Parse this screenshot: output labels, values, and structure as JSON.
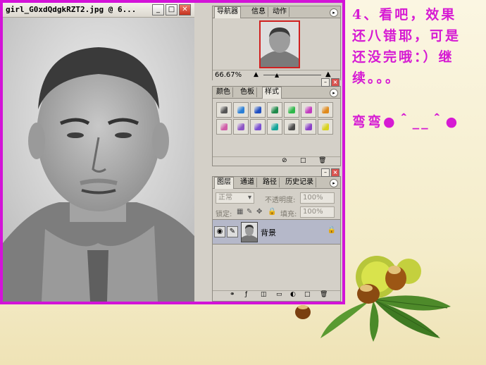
{
  "document": {
    "title": "girl_G0xdQdgkRZT2.jpg @ 6...",
    "minimize_icon": "minimize-icon",
    "maximize_icon": "maximize-icon",
    "close_icon": "close-icon"
  },
  "navigator_panel": {
    "tabs": [
      "导航器",
      "信息",
      "动作"
    ],
    "zoom": "66.67%"
  },
  "styles_panel": {
    "tabs": [
      "颜色",
      "色板",
      "样式"
    ],
    "swatch_colors": [
      "#555555",
      "#2a7fd6",
      "#1f4fc2",
      "#1e8a4a",
      "#2fb84a",
      "#c23bbf",
      "#e08a1c",
      "#d05da8",
      "#8d55c4",
      "#7a4fd1",
      "#15a59a",
      "#4a4a4a",
      "#8a3fc7",
      "#d8d21e"
    ]
  },
  "layers_panel": {
    "tabs": [
      "图层",
      "通道",
      "路径",
      "历史记录"
    ],
    "blend_mode": "正常",
    "opacity_label": "不透明度:",
    "opacity_value": "100%",
    "lock_label": "锁定:",
    "fill_label": "填充:",
    "fill_value": "100%",
    "layer_name": "背景"
  },
  "slide_text": {
    "line1": "4、看吧，效果",
    "line2": "还八错耶，可是",
    "line3": "还没完哦：）继",
    "line4": "续。。。",
    "emoticon": "弯弯●＾__＾●"
  },
  "colors": {
    "frame": "#d313d8",
    "text": "#d61ad3"
  }
}
